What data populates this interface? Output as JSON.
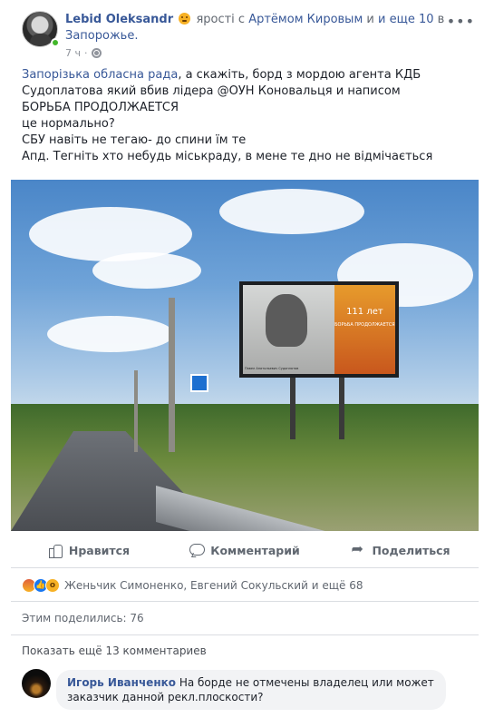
{
  "header": {
    "author": "Lebid Oleksandr",
    "activity_prefix": "ярості с",
    "with_person": "Артёмом Кировым",
    "and_others": "и еще 10",
    "in_label": "в",
    "location": "Запорожье.",
    "time": "7 ч",
    "feeling_icon": "angry-face-emoji",
    "more_icon": "ellipsis-icon"
  },
  "post": {
    "lines": [
      {
        "link": "Запорізька обласна рада",
        "text": ", а скажіть, борд з мордою агента КДБ"
      },
      {
        "text": "Судоплатова який вбив лідера @ОУН Коновальця и написом"
      },
      {
        "text": "БОРЬБА ПРОДОЛЖАЕТСЯ"
      },
      {
        "text": "це нормально?"
      },
      {
        "text": "СБУ навіть не тегаю- до спини їм те"
      },
      {
        "text": "Апд. Тегніть хто небудь міськраду, в мене те дно не відмічається"
      }
    ]
  },
  "photo": {
    "billboard_big_text": "111 лет",
    "billboard_small_text": "БОРЬБА ПРОДОЛЖАЕТСЯ",
    "billboard_caption": "Павел Анатольевич Судоплатов"
  },
  "actions": {
    "like": "Нравится",
    "comment": "Комментарий",
    "share": "Поделиться"
  },
  "reactions": {
    "names": "Женьчик Симоненко, Евгений Сокульский и ещё 68",
    "icons": [
      "angry-icon",
      "like-icon",
      "wow-icon"
    ]
  },
  "shares": "Этим поделились: 76",
  "show_more_comments": "Показать ещё 13 комментариев",
  "comment": {
    "author": "Игорь Иванченко",
    "text": "На борде не отмечены владелец или может заказчик данной рекл.плоскости?"
  },
  "colors": {
    "link": "#385898",
    "secondary_text": "#616770",
    "divider": "#dadde1",
    "online": "#42b72a"
  }
}
